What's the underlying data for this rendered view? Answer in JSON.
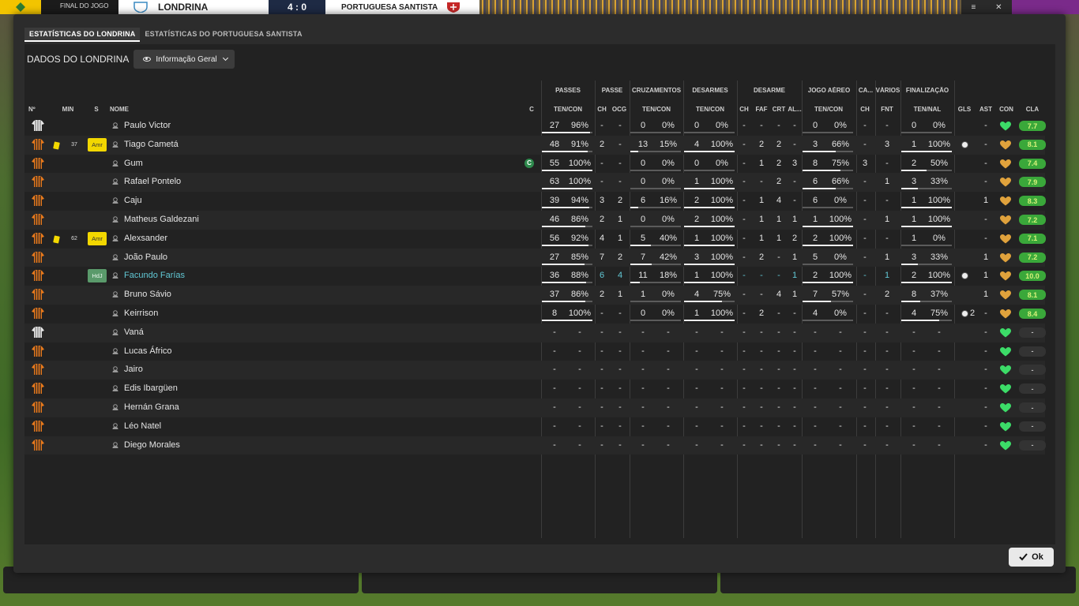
{
  "topbar": {
    "final_label": "FINAL DO JOGO",
    "home_team": "LONDRINA",
    "score": "4 : 0",
    "away_team": "PORTUGUESA SANTISTA",
    "close_label": "✕"
  },
  "tabs": [
    {
      "label": "ESTATÍSTICAS DO LONDRINA",
      "active": true
    },
    {
      "label": "ESTATÍSTICAS DO PORTUGUESA SANTISTA",
      "active": false
    }
  ],
  "panel": {
    "dados_label": "DADOS DO LONDRINA",
    "dropdown_label": "Informação Geral"
  },
  "group_headers": {
    "passes": "PASSES",
    "passe": "PASSE",
    "cruzamentos": "CRUZAMENTOS",
    "desarmes": "DESARMES",
    "desarme": "DESARME",
    "jogo_aereo": "JOGO AÉREO",
    "ca": "CA...",
    "varios": "VÁRIOS",
    "finalizacao": "FINALIZAÇÃO"
  },
  "col_headers": {
    "num": "Nº",
    "min": "MIN",
    "s": "S",
    "nome": "NOME",
    "c": "C",
    "passes_tc": "TEN/CON",
    "passe_ch": "CH",
    "passe_ocg": "OCG",
    "cruz_tc": "TEN/CON",
    "des_tc": "TEN/CON",
    "desarme_ch": "CH",
    "desarme_faf": "FAF",
    "desarme_crt": "CRT",
    "desarme_al": "AL...",
    "aereo_tc": "TEN/CON",
    "ca_ch": "CH",
    "varios_fnt": "FNT",
    "fin_tn": "TEN/NAL",
    "gls": "GLS",
    "ast": "AST",
    "con": "CON",
    "cla": "CLA"
  },
  "colors": {
    "accent_blue": "#61c7d4",
    "rating_green": "#3aa83a",
    "yellow_card": "#f4d900",
    "heart_green": "#3cdc68",
    "heart_orange": "#e0a23c"
  },
  "players": [
    {
      "kit": "gk",
      "yellow": false,
      "min": "",
      "sub": "",
      "name": "Paulo Victor",
      "hl": false,
      "cap": false,
      "pt": "27",
      "pp": "96%",
      "pch": "-",
      "pocg": "-",
      "ct": "0",
      "cp": "0%",
      "dt": "0",
      "dp": "0%",
      "dch": "-",
      "dfaf": "-",
      "dcrt": "-",
      "dal": "-",
      "at": "0",
      "ap": "0%",
      "cach": "-",
      "fnt": "-",
      "ft": "0",
      "fp": "0%",
      "gls": "",
      "ast": "-",
      "con": "green",
      "cla": "7.7",
      "r_pass": 0.96,
      "r_cruz": 0,
      "r_des": 0,
      "r_aer": 0,
      "r_fin": 0
    },
    {
      "kit": "out",
      "yellow": true,
      "min": "37",
      "sub": "Amr",
      "name": "Tiago Cametá",
      "hl": false,
      "cap": false,
      "pt": "48",
      "pp": "91%",
      "pch": "2",
      "pocg": "-",
      "ct": "13",
      "cp": "15%",
      "dt": "4",
      "dp": "100%",
      "dch": "-",
      "dfaf": "2",
      "dcrt": "2",
      "dal": "-",
      "at": "3",
      "ap": "66%",
      "cach": "-",
      "fnt": "3",
      "ft": "1",
      "fp": "100%",
      "gls": "1",
      "ast": "-",
      "con": "orange",
      "cla": "8.1",
      "r_pass": 0.91,
      "r_cruz": 0.15,
      "r_des": 1,
      "r_aer": 0.66,
      "r_fin": 1
    },
    {
      "kit": "out",
      "yellow": false,
      "min": "",
      "sub": "",
      "name": "Gum",
      "hl": false,
      "cap": true,
      "cap_label": "C",
      "pt": "55",
      "pp": "100%",
      "pch": "-",
      "pocg": "-",
      "ct": "0",
      "cp": "0%",
      "dt": "0",
      "dp": "0%",
      "dch": "-",
      "dfaf": "1",
      "dcrt": "2",
      "dal": "3",
      "at": "8",
      "ap": "75%",
      "cach": "3",
      "fnt": "-",
      "ft": "2",
      "fp": "50%",
      "gls": "",
      "ast": "-",
      "con": "orange",
      "cla": "7.4",
      "r_pass": 1,
      "r_cruz": 0,
      "r_des": 0,
      "r_aer": 0.75,
      "r_fin": 0.5
    },
    {
      "kit": "out",
      "yellow": false,
      "min": "",
      "sub": "",
      "name": "Rafael Pontelo",
      "hl": false,
      "cap": false,
      "pt": "63",
      "pp": "100%",
      "pch": "-",
      "pocg": "-",
      "ct": "0",
      "cp": "0%",
      "dt": "1",
      "dp": "100%",
      "dch": "-",
      "dfaf": "-",
      "dcrt": "2",
      "dal": "-",
      "at": "6",
      "ap": "66%",
      "cach": "-",
      "fnt": "1",
      "ft": "3",
      "fp": "33%",
      "gls": "",
      "ast": "-",
      "con": "orange",
      "cla": "7.9",
      "r_pass": 1,
      "r_cruz": 0,
      "r_des": 1,
      "r_aer": 0.66,
      "r_fin": 0.33
    },
    {
      "kit": "out",
      "yellow": false,
      "min": "",
      "sub": "",
      "name": "Caju",
      "hl": false,
      "cap": false,
      "pt": "39",
      "pp": "94%",
      "pch": "3",
      "pocg": "2",
      "ct": "6",
      "cp": "16%",
      "dt": "2",
      "dp": "100%",
      "dch": "-",
      "dfaf": "1",
      "dcrt": "4",
      "dal": "-",
      "at": "6",
      "ap": "0%",
      "cach": "-",
      "fnt": "-",
      "ft": "1",
      "fp": "100%",
      "gls": "",
      "ast": "1",
      "con": "orange",
      "cla": "8.3",
      "r_pass": 0.94,
      "r_cruz": 0.16,
      "r_des": 1,
      "r_aer": 0,
      "r_fin": 1
    },
    {
      "kit": "out",
      "yellow": false,
      "min": "",
      "sub": "",
      "name": "Matheus Galdezani",
      "hl": false,
      "cap": false,
      "pt": "46",
      "pp": "86%",
      "pch": "2",
      "pocg": "1",
      "ct": "0",
      "cp": "0%",
      "dt": "2",
      "dp": "100%",
      "dch": "-",
      "dfaf": "1",
      "dcrt": "1",
      "dal": "1",
      "at": "1",
      "ap": "100%",
      "cach": "-",
      "fnt": "1",
      "ft": "1",
      "fp": "100%",
      "gls": "",
      "ast": "-",
      "con": "orange",
      "cla": "7.2",
      "r_pass": 0.86,
      "r_cruz": 0,
      "r_des": 1,
      "r_aer": 1,
      "r_fin": 1
    },
    {
      "kit": "out",
      "yellow": true,
      "min": "62",
      "sub": "Amr",
      "name": "Alexsander",
      "hl": false,
      "cap": false,
      "pt": "56",
      "pp": "92%",
      "pch": "4",
      "pocg": "1",
      "ct": "5",
      "cp": "40%",
      "dt": "1",
      "dp": "100%",
      "dch": "-",
      "dfaf": "1",
      "dcrt": "1",
      "dal": "2",
      "at": "2",
      "ap": "100%",
      "cach": "-",
      "fnt": "-",
      "ft": "1",
      "fp": "0%",
      "gls": "",
      "ast": "-",
      "con": "orange",
      "cla": "7.1",
      "r_pass": 0.92,
      "r_cruz": 0.4,
      "r_des": 1,
      "r_aer": 1,
      "r_fin": 0
    },
    {
      "kit": "out",
      "yellow": false,
      "min": "",
      "sub": "",
      "name": "João Paulo",
      "hl": false,
      "cap": false,
      "pt": "27",
      "pp": "85%",
      "pch": "7",
      "pocg": "2",
      "ct": "7",
      "cp": "42%",
      "dt": "3",
      "dp": "100%",
      "dch": "-",
      "dfaf": "2",
      "dcrt": "-",
      "dal": "1",
      "at": "5",
      "ap": "0%",
      "cach": "-",
      "fnt": "1",
      "ft": "3",
      "fp": "33%",
      "gls": "",
      "ast": "1",
      "con": "orange",
      "cla": "7.2",
      "r_pass": 0.85,
      "r_cruz": 0.42,
      "r_des": 1,
      "r_aer": 0,
      "r_fin": 0.33
    },
    {
      "kit": "out",
      "yellow": false,
      "min": "",
      "sub": "HdJ",
      "name": "Facundo Farías",
      "hl": true,
      "cap": false,
      "pt": "36",
      "pp": "88%",
      "pch": "6",
      "pocg": "4",
      "ct": "11",
      "cp": "18%",
      "dt": "1",
      "dp": "100%",
      "dch": "-",
      "dfaf": "-",
      "dcrt": "-",
      "dal": "1",
      "at": "2",
      "ap": "100%",
      "cach": "-",
      "fnt": "1",
      "ft": "2",
      "fp": "100%",
      "gls": "1",
      "ast": "1",
      "con": "orange",
      "cla": "10.0",
      "r_pass": 0.88,
      "r_cruz": 0.18,
      "r_des": 1,
      "r_aer": 1,
      "r_fin": 1
    },
    {
      "kit": "out",
      "yellow": false,
      "min": "",
      "sub": "",
      "name": "Bruno Sávio",
      "hl": false,
      "cap": false,
      "pt": "37",
      "pp": "86%",
      "pch": "2",
      "pocg": "1",
      "ct": "1",
      "cp": "0%",
      "dt": "4",
      "dp": "75%",
      "dch": "-",
      "dfaf": "-",
      "dcrt": "4",
      "dal": "1",
      "at": "7",
      "ap": "57%",
      "cach": "-",
      "fnt": "2",
      "ft": "8",
      "fp": "37%",
      "gls": "",
      "ast": "1",
      "con": "orange",
      "cla": "8.1",
      "r_pass": 0.86,
      "r_cruz": 0,
      "r_des": 0.75,
      "r_aer": 0.57,
      "r_fin": 0.37
    },
    {
      "kit": "out",
      "yellow": false,
      "min": "",
      "sub": "",
      "name": "Keirrison",
      "hl": false,
      "cap": false,
      "pt": "8",
      "pp": "100%",
      "pch": "-",
      "pocg": "-",
      "ct": "0",
      "cp": "0%",
      "dt": "1",
      "dp": "100%",
      "dch": "-",
      "dfaf": "2",
      "dcrt": "-",
      "dal": "-",
      "at": "4",
      "ap": "0%",
      "cach": "-",
      "fnt": "-",
      "ft": "4",
      "fp": "75%",
      "gls": "2",
      "ast": "-",
      "con": "orange",
      "cla": "8.4",
      "r_pass": 1,
      "r_cruz": 0,
      "r_des": 1,
      "r_aer": 0,
      "r_fin": 0.75
    },
    {
      "kit": "gk",
      "yellow": false,
      "min": "",
      "sub": "",
      "name": "Vaná",
      "hl": false,
      "cap": false,
      "pt": "-",
      "pp": "-",
      "pch": "-",
      "pocg": "-",
      "ct": "-",
      "cp": "-",
      "dt": "-",
      "dp": "-",
      "dch": "-",
      "dfaf": "-",
      "dcrt": "-",
      "dal": "-",
      "at": "-",
      "ap": "-",
      "cach": "-",
      "fnt": "-",
      "ft": "-",
      "fp": "-",
      "gls": "",
      "ast": "-",
      "con": "green",
      "cla": "-"
    },
    {
      "kit": "out",
      "yellow": false,
      "min": "",
      "sub": "",
      "name": "Lucas Áfrico",
      "hl": false,
      "cap": false,
      "pt": "-",
      "pp": "-",
      "pch": "-",
      "pocg": "-",
      "ct": "-",
      "cp": "-",
      "dt": "-",
      "dp": "-",
      "dch": "-",
      "dfaf": "-",
      "dcrt": "-",
      "dal": "-",
      "at": "-",
      "ap": "-",
      "cach": "-",
      "fnt": "-",
      "ft": "-",
      "fp": "-",
      "gls": "",
      "ast": "-",
      "con": "green",
      "cla": "-"
    },
    {
      "kit": "out",
      "yellow": false,
      "min": "",
      "sub": "",
      "name": "Jairo",
      "hl": false,
      "cap": false,
      "pt": "-",
      "pp": "-",
      "pch": "-",
      "pocg": "-",
      "ct": "-",
      "cp": "-",
      "dt": "-",
      "dp": "-",
      "dch": "-",
      "dfaf": "-",
      "dcrt": "-",
      "dal": "-",
      "at": "-",
      "ap": "-",
      "cach": "-",
      "fnt": "-",
      "ft": "-",
      "fp": "-",
      "gls": "",
      "ast": "-",
      "con": "green",
      "cla": "-"
    },
    {
      "kit": "out",
      "yellow": false,
      "min": "",
      "sub": "",
      "name": "Edis Ibargüen",
      "hl": false,
      "cap": false,
      "pt": "-",
      "pp": "-",
      "pch": "-",
      "pocg": "-",
      "ct": "-",
      "cp": "-",
      "dt": "-",
      "dp": "-",
      "dch": "-",
      "dfaf": "-",
      "dcrt": "-",
      "dal": "-",
      "at": "-",
      "ap": "-",
      "cach": "-",
      "fnt": "-",
      "ft": "-",
      "fp": "-",
      "gls": "",
      "ast": "-",
      "con": "green",
      "cla": "-"
    },
    {
      "kit": "out",
      "yellow": false,
      "min": "",
      "sub": "",
      "name": "Hernán Grana",
      "hl": false,
      "cap": false,
      "pt": "-",
      "pp": "-",
      "pch": "-",
      "pocg": "-",
      "ct": "-",
      "cp": "-",
      "dt": "-",
      "dp": "-",
      "dch": "-",
      "dfaf": "-",
      "dcrt": "-",
      "dal": "-",
      "at": "-",
      "ap": "-",
      "cach": "-",
      "fnt": "-",
      "ft": "-",
      "fp": "-",
      "gls": "",
      "ast": "-",
      "con": "green",
      "cla": "-"
    },
    {
      "kit": "out",
      "yellow": false,
      "min": "",
      "sub": "",
      "name": "Léo Natel",
      "hl": false,
      "cap": false,
      "pt": "-",
      "pp": "-",
      "pch": "-",
      "pocg": "-",
      "ct": "-",
      "cp": "-",
      "dt": "-",
      "dp": "-",
      "dch": "-",
      "dfaf": "-",
      "dcrt": "-",
      "dal": "-",
      "at": "-",
      "ap": "-",
      "cach": "-",
      "fnt": "-",
      "ft": "-",
      "fp": "-",
      "gls": "",
      "ast": "-",
      "con": "green",
      "cla": "-"
    },
    {
      "kit": "out",
      "yellow": false,
      "min": "",
      "sub": "",
      "name": "Diego Morales",
      "hl": false,
      "cap": false,
      "pt": "-",
      "pp": "-",
      "pch": "-",
      "pocg": "-",
      "ct": "-",
      "cp": "-",
      "dt": "-",
      "dp": "-",
      "dch": "-",
      "dfaf": "-",
      "dcrt": "-",
      "dal": "-",
      "at": "-",
      "ap": "-",
      "cach": "-",
      "fnt": "-",
      "ft": "-",
      "fp": "-",
      "gls": "",
      "ast": "-",
      "con": "green",
      "cla": "-"
    }
  ],
  "ok_label": "Ok"
}
